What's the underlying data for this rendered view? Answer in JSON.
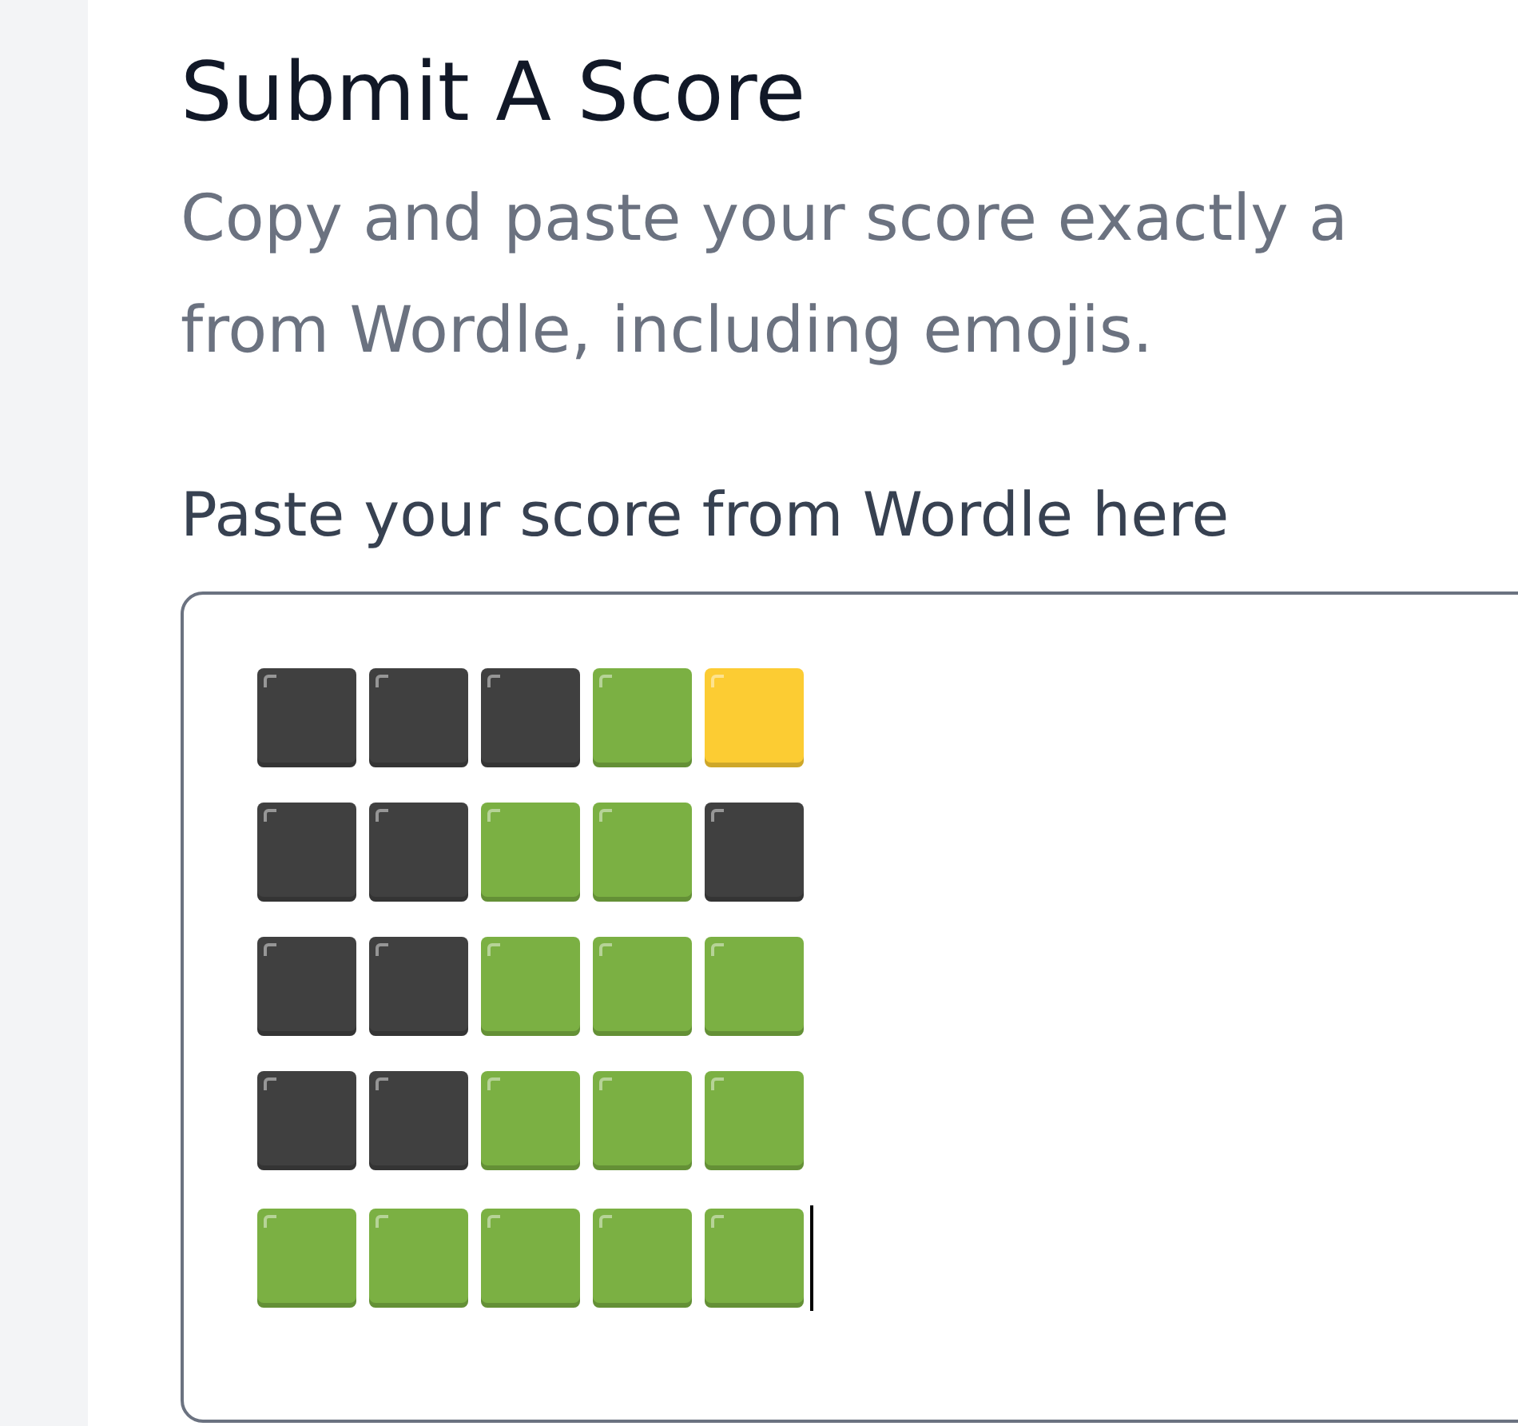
{
  "title": "Submit A Score",
  "description_lines": [
    "Copy and paste your score exactly a",
    "from Wordle, including emojis."
  ],
  "score_field": {
    "label": "Paste your score from Wordle here",
    "focused": true,
    "rows": [
      {
        "tiles": [
          {
            "color": "#404040"
          },
          {
            "color": "#404040"
          },
          {
            "color": "#404040"
          },
          {
            "color": "#7bb043"
          },
          {
            "color": "#fccc33"
          }
        ]
      },
      {
        "tiles": [
          {
            "color": "#404040"
          },
          {
            "color": "#404040"
          },
          {
            "color": "#7bb043"
          },
          {
            "color": "#7bb043"
          },
          {
            "color": "#404040"
          }
        ]
      },
      {
        "tiles": [
          {
            "color": "#404040"
          },
          {
            "color": "#404040"
          },
          {
            "color": "#7bb043"
          },
          {
            "color": "#7bb043"
          },
          {
            "color": "#7bb043"
          }
        ]
      },
      {
        "tiles": [
          {
            "color": "#404040"
          },
          {
            "color": "#404040"
          },
          {
            "color": "#7bb043"
          },
          {
            "color": "#7bb043"
          },
          {
            "color": "#7bb043"
          }
        ]
      },
      {
        "tiles": [
          {
            "color": "#7bb043"
          },
          {
            "color": "#7bb043"
          },
          {
            "color": "#7bb043"
          },
          {
            "color": "#7bb043"
          },
          {
            "color": "#7bb043"
          }
        ]
      }
    ]
  }
}
